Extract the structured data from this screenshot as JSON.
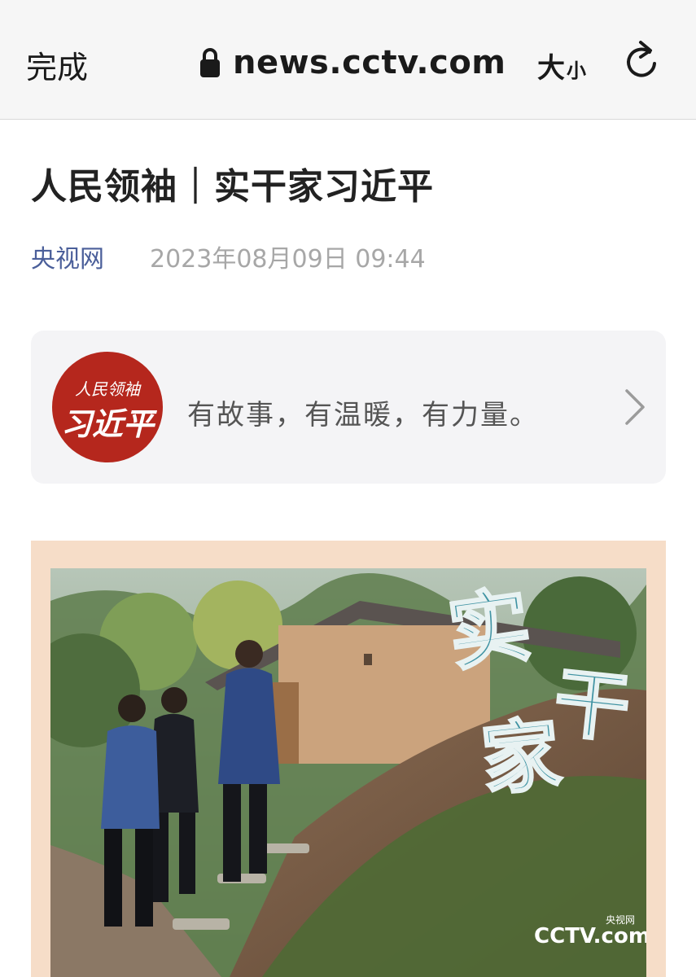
{
  "browser": {
    "done_label": "完成",
    "domain": "news.cctv.com",
    "text_size_big": "大",
    "text_size_small": "小"
  },
  "icons": {
    "lock": "lock-icon",
    "reload": "reload-icon",
    "chevron": "chevron-right-icon"
  },
  "article": {
    "title": "人民领袖｜实干家习近平",
    "source": "央视网",
    "timestamp": "2023年08月09日 09:44"
  },
  "series_card": {
    "seal_line1": "人民领袖",
    "seal_line2": "习近平",
    "slogan": "有故事，有温暖，有力量。"
  },
  "hero_image": {
    "overlay_char1": "实",
    "overlay_char2": "干",
    "overlay_char3": "家",
    "watermark": "CCTV.com",
    "watermark_cn": "央视网"
  },
  "colors": {
    "source_link": "#4b5f9a",
    "seal_red": "#b5271d",
    "overlay_teal": "#3f93a3",
    "frame_peach": "#f6ddc8"
  }
}
